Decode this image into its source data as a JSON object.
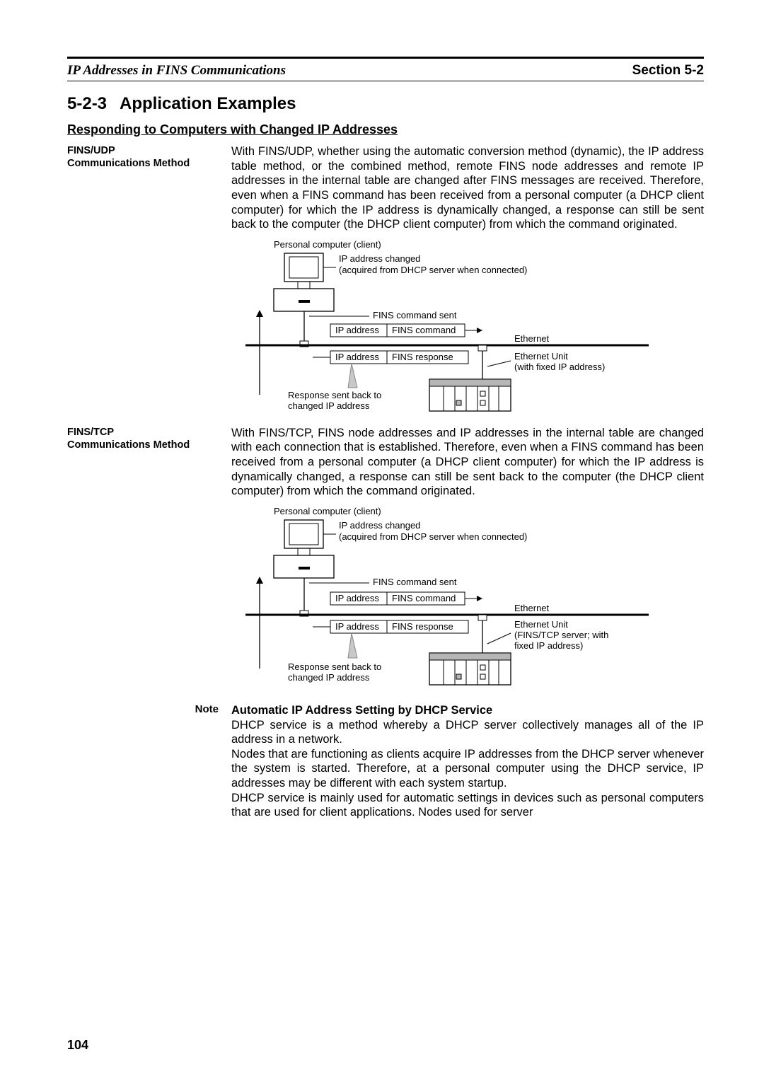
{
  "header": {
    "left": "IP Addresses in FINS Communications",
    "right": "Section 5-2"
  },
  "section": {
    "number": "5-2-3",
    "title": "Application Examples"
  },
  "subsection": "Responding to Computers with Changed IP Addresses",
  "fins_udp": {
    "label1": "FINS/UDP",
    "label2": "Communications Method",
    "body": "With FINS/UDP, whether using the automatic conversion method (dynamic), the IP address table method, or the combined method, remote FINS node addresses and remote IP addresses in the internal table are changed after FINS messages are received. Therefore, even when a FINS command has been received from a personal computer (a DHCP client computer) for which the IP address is dynamically changed, a response can still be sent back to the computer (the DHCP client computer) from which the command originated."
  },
  "fins_tcp": {
    "label1": "FINS/TCP",
    "label2": "Communications Method",
    "body": "With FINS/TCP, FINS node addresses and IP addresses in the internal table are changed with each connection that is established. Therefore, even when a FINS command has been received from a personal computer (a DHCP client computer) for which the IP address is dynamically changed, a response can still be sent back to the computer (the DHCP client computer) from which the command originated."
  },
  "diagram1": {
    "pc_label": "Personal computer (client)",
    "ip_changed_l1": "IP address changed",
    "ip_changed_l2": "(acquired from DHCP server when connected)",
    "cmd_sent": "FINS command sent",
    "box_ip": "IP address",
    "box_cmd": "FINS command",
    "box_resp": "FINS response",
    "ethernet": "Ethernet",
    "eth_unit_l1": "Ethernet Unit",
    "eth_unit_l2": "(with fixed IP address)",
    "resp_l1": "Response sent back to",
    "resp_l2": "changed IP address"
  },
  "diagram2": {
    "pc_label": "Personal computer (client)",
    "ip_changed_l1": "IP address changed",
    "ip_changed_l2": "(acquired from DHCP server when connected)",
    "cmd_sent": "FINS command sent",
    "box_ip": "IP address",
    "box_cmd": "FINS command",
    "box_resp": "FINS response",
    "ethernet": "Ethernet",
    "eth_unit_l1": "Ethernet Unit",
    "eth_unit_l2": "(FINS/TCP server; with",
    "eth_unit_l3": "fixed IP address)",
    "resp_l1": "Response sent back to",
    "resp_l2": "changed IP address"
  },
  "note": {
    "label": "Note",
    "title": "Automatic IP Address Setting by DHCP Service",
    "p1": "DHCP service is a method whereby a DHCP server collectively manages all of the IP address in a network.",
    "p2": "Nodes that are functioning as clients acquire IP addresses from the DHCP server whenever the system is started. Therefore, at a personal computer using the DHCP service, IP addresses may be different with each system startup.",
    "p3": "DHCP service is mainly used for automatic settings in devices such as personal computers that are used for client applications. Nodes used for server"
  },
  "page_number": "104"
}
